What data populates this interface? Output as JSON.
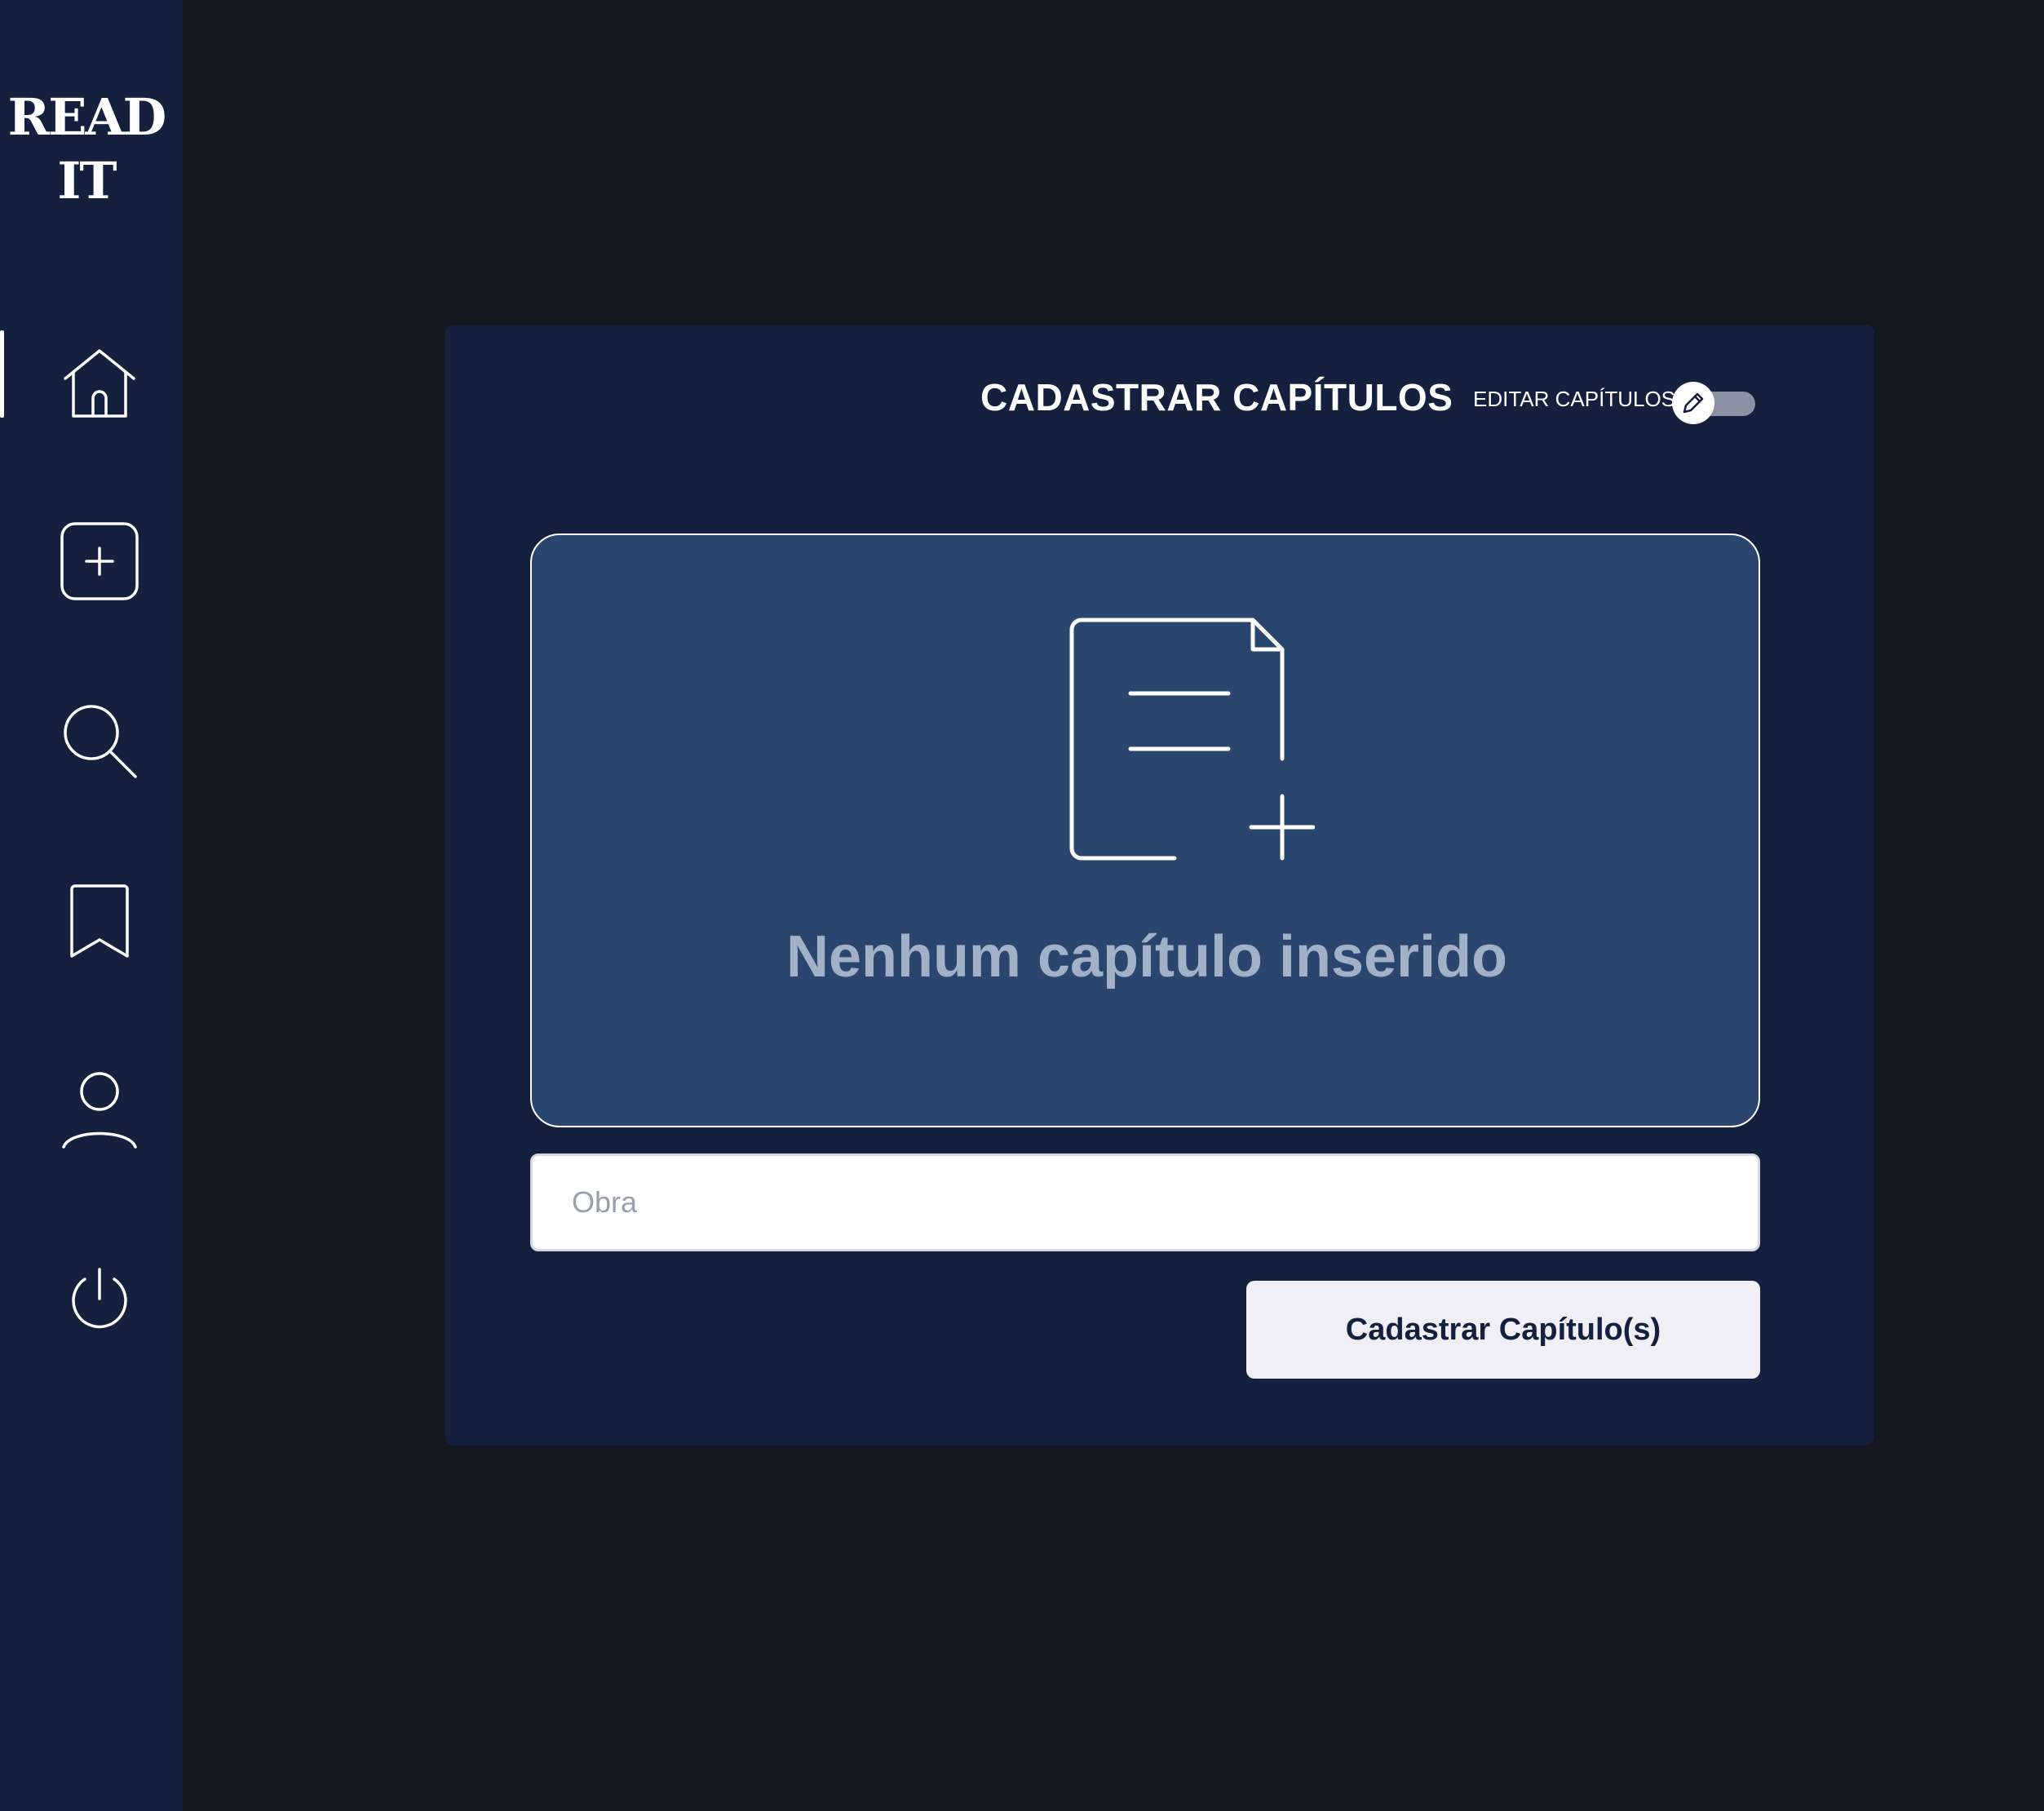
{
  "app": {
    "logo_line1": "READ",
    "logo_line2": "IT"
  },
  "sidebar": {
    "items": [
      {
        "name": "home",
        "icon": "home-icon",
        "active": true
      },
      {
        "name": "add",
        "icon": "plus-square-icon",
        "active": false
      },
      {
        "name": "search",
        "icon": "search-icon",
        "active": false
      },
      {
        "name": "bookmarks",
        "icon": "bookmark-icon",
        "active": false
      },
      {
        "name": "profile",
        "icon": "user-icon",
        "active": false
      },
      {
        "name": "logout",
        "icon": "power-icon",
        "active": false
      }
    ]
  },
  "panel": {
    "title": "CADASTRAR CAPÍTULOS",
    "edit_toggle": {
      "label": "EDITAR CAPÍTULOS",
      "checked": false,
      "icon": "pencil-icon"
    },
    "dropzone": {
      "icon": "document-add-icon",
      "empty_text": "Nenhum capítulo inserido"
    },
    "obra_input": {
      "placeholder": "Obra",
      "value": ""
    },
    "submit_label": "Cadastrar Capítulo(s)"
  },
  "colors": {
    "page_bg": "#15181e",
    "sidebar_bg": "#14203d",
    "panel_bg": "#14203d",
    "dropzone_bg": "#2a466e",
    "empty_text": "#a3b1c8",
    "button_bg": "#efeff5"
  }
}
